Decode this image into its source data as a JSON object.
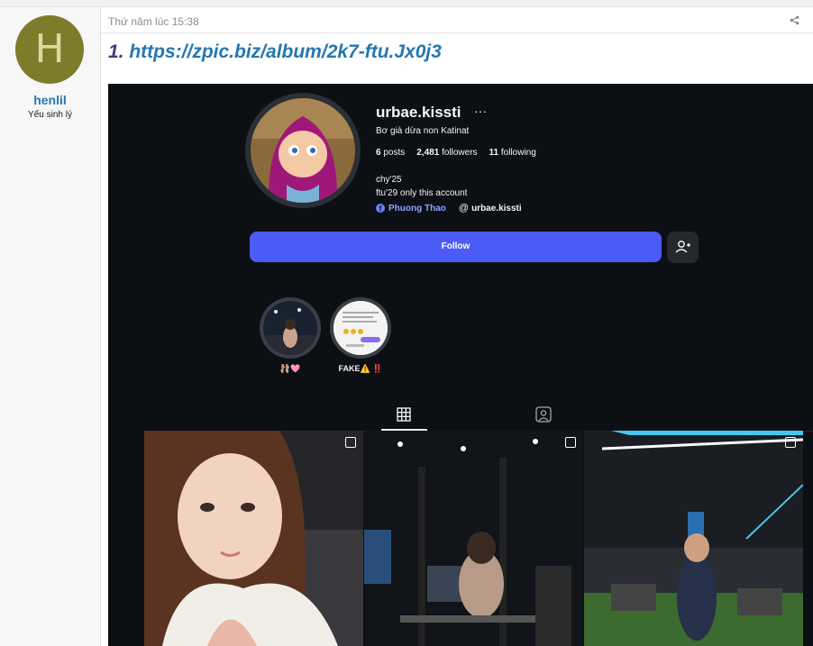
{
  "forum": {
    "user": {
      "initial": "H",
      "name": "henlil",
      "title": "Yếu sinh lý"
    },
    "post_time": "Thứ năm lúc 15:38",
    "link_number": "1.",
    "link_text": "https://zpic.biz/album/2k7-ftu.Jx0j3"
  },
  "profile": {
    "handle": "urbae.kissti",
    "more_icon": "ellipsis-icon",
    "bio_name": "Bơ già dừa non Katinat",
    "stats": {
      "posts": "6",
      "posts_label": "posts",
      "followers": "2,481",
      "followers_label": "followers",
      "following": "11",
      "following_label": "following"
    },
    "bio_line1": "chy'25",
    "bio_line2": "ftu'29 only this account",
    "facebook_link": "Phuong Thao",
    "threads_link": "urbae.kissti",
    "follow_label": "Follow",
    "highlights": [
      {
        "label": "🩰🩷"
      },
      {
        "label": "FAKE⚠️ ‼️"
      }
    ],
    "tabs": [
      "grid-icon",
      "tagged-icon"
    ]
  },
  "colors": {
    "link": "#2577b1",
    "follow": "#4a5cf5",
    "ig_bg": "#0c1014"
  }
}
